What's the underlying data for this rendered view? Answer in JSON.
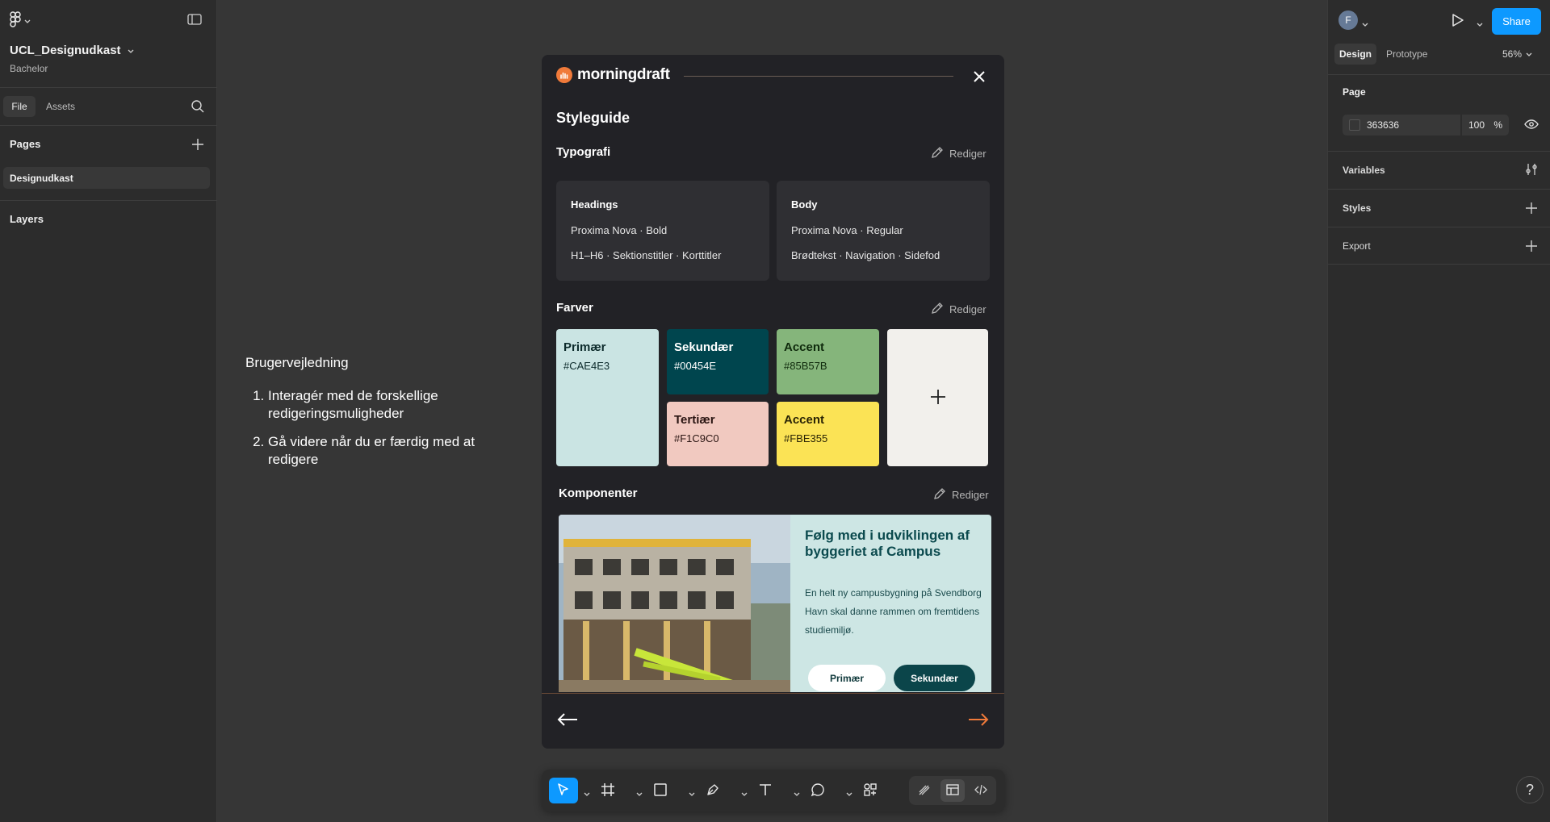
{
  "app": {
    "file_title": "UCL_Designudkast",
    "file_subtitle": "Bachelor"
  },
  "left_panel": {
    "tabs": [
      {
        "label": "File"
      },
      {
        "label": "Assets"
      }
    ],
    "pages_heading": "Pages",
    "pages": [
      {
        "label": "Designudkast"
      }
    ],
    "layers_heading": "Layers"
  },
  "canvas_note": {
    "title": "Brugervejledning",
    "steps": [
      "Interagér med de forskellige redigeringsmuligheder",
      "Gå videre når du er færdig med at redigere"
    ]
  },
  "frame": {
    "brand": "morningdraft",
    "title": "Styleguide",
    "edit_label": "Rediger",
    "typography": {
      "heading": "Typografi",
      "cards": [
        {
          "title": "Headings",
          "font": "Proxima Nova · Bold",
          "usage": "H1–H6 · Sektionstitler · Korttitler"
        },
        {
          "title": "Body",
          "font": "Proxima Nova · Regular",
          "usage": "Brødtekst · Navigation · Sidefod"
        }
      ]
    },
    "colors": {
      "heading": "Farver",
      "swatches": [
        {
          "name": "Primær",
          "hex": "#CAE4E3"
        },
        {
          "name": "Sekundær",
          "hex": "#00454E"
        },
        {
          "name": "Accent",
          "hex": "#85B57B"
        },
        {
          "name": "Tertiær",
          "hex": "#F1C9C0"
        },
        {
          "name": "Accent",
          "hex": "#FBE355"
        }
      ],
      "add_symbol": "+"
    },
    "components": {
      "heading": "Komponenter",
      "card_title": "Følg med i udviklingen af byggeriet af Campus",
      "card_text": "En helt ny campusbygning på Svendborg Havn skal danne rammen om fremtidens studiemiljø.",
      "primary_button": "Primær",
      "secondary_button": "Sekundær"
    }
  },
  "right_panel": {
    "avatar_initial": "F",
    "share_label": "Share",
    "tabs": [
      {
        "label": "Design"
      },
      {
        "label": "Prototype"
      }
    ],
    "zoom": "56%",
    "page_heading": "Page",
    "page_fill_hex": "363636",
    "page_fill_opacity": "100",
    "percent_sign": "%",
    "variables_label": "Variables",
    "styles_label": "Styles",
    "export_label": "Export"
  },
  "help_label": "?",
  "colors": {
    "canvas": "#363636",
    "panel": "#2c2c2c",
    "accent_blue": "#0d99ff",
    "brand_orange": "#f07a3a"
  }
}
